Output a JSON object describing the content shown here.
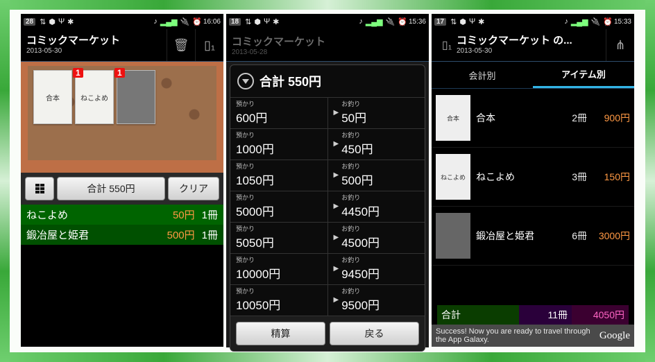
{
  "phone1": {
    "status": {
      "notif": "28",
      "time": "16:06"
    },
    "title": "コミックマーケット",
    "date": "2013-05-30",
    "total_btn": "合計 550円",
    "clear_btn": "クリア",
    "shelf": [
      {
        "label": "合本",
        "tag": ""
      },
      {
        "label": "ねこよめ",
        "tag": "1"
      },
      {
        "label": "",
        "tag": "1",
        "photo": true
      }
    ],
    "lines": [
      {
        "name": "ねこよめ",
        "price": "50円",
        "qty": "1冊"
      },
      {
        "name": "鍛冶屋と姫君",
        "price": "500円",
        "qty": "1冊"
      }
    ]
  },
  "phone2": {
    "status": {
      "notif": "18",
      "time": "15:36"
    },
    "dim_title": "コミックマーケット",
    "dim_date": "2013-05-28",
    "dlg_title": "合計 550円",
    "label_deposit": "預かり",
    "label_change": "お釣り",
    "rows": [
      {
        "deposit": "600円",
        "change": "50円"
      },
      {
        "deposit": "1000円",
        "change": "450円"
      },
      {
        "deposit": "1050円",
        "change": "500円"
      },
      {
        "deposit": "5000円",
        "change": "4450円"
      },
      {
        "deposit": "5050円",
        "change": "4500円"
      },
      {
        "deposit": "10000円",
        "change": "9450円"
      },
      {
        "deposit": "10050円",
        "change": "9500円"
      }
    ],
    "btn_settle": "精算",
    "btn_back": "戻る"
  },
  "phone3": {
    "status": {
      "notif": "17",
      "time": "15:33"
    },
    "title": "コミックマーケット の...",
    "date": "2013-05-30",
    "tab_a": "会計別",
    "tab_b": "アイテム別",
    "items": [
      {
        "name": "合本",
        "qty": "2冊",
        "amount": "900円",
        "thumb": "合本"
      },
      {
        "name": "ねこよめ",
        "qty": "3冊",
        "amount": "150円",
        "thumb": "ねこよめ"
      },
      {
        "name": "鍛冶屋と姫君",
        "qty": "6冊",
        "amount": "3000円",
        "thumb": "",
        "photo": true
      }
    ],
    "total_label": "合計",
    "total_qty": "11冊",
    "total_amount": "4050円",
    "ad_text": "Success! Now you are ready to travel through the App Galaxy.",
    "ad_brand": "Google"
  },
  "status_icons": [
    "⇅",
    "⬢",
    "⇵",
    "☍",
    "✱",
    "♪",
    "⚙",
    "📶",
    "⏰",
    "🔌"
  ]
}
